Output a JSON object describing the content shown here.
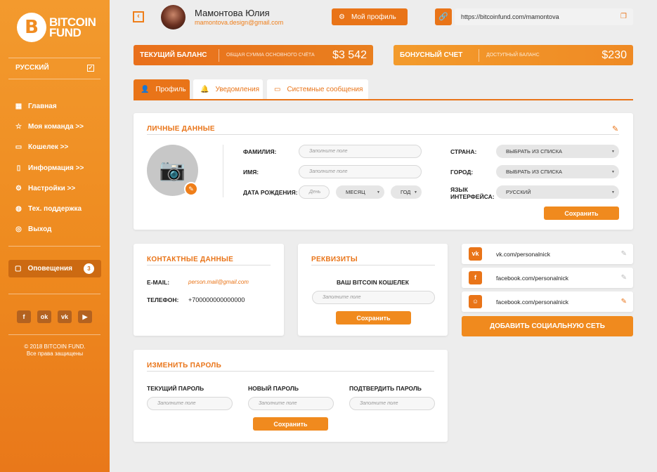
{
  "brand": {
    "line1": "BITCOIN",
    "line2": "FUND",
    "letter": "B"
  },
  "sidebar": {
    "language": "РУССКИЙ",
    "items": [
      {
        "label": "Главная",
        "icon": "grid-icon"
      },
      {
        "label": "Моя команда >>",
        "icon": "star-icon"
      },
      {
        "label": "Кошелек >>",
        "icon": "wallet-icon"
      },
      {
        "label": "Информация >>",
        "icon": "bookmark-icon"
      },
      {
        "label": "Настройки >>",
        "icon": "gear-icon"
      },
      {
        "label": "Тех. поддержка",
        "icon": "globe-icon"
      },
      {
        "label": "Выход",
        "icon": "power-icon"
      }
    ],
    "notifications": {
      "label": "Оповещения",
      "count": "3"
    },
    "socials": [
      "f",
      "ok",
      "vk",
      "yt"
    ],
    "copyright": "© 2018 BITCOIN FUND.",
    "rights": "Все права защищены"
  },
  "header": {
    "user_name": "Мамонтова Юлия",
    "user_email": "mamontova.design@gmail.com",
    "profile_button": "Мой профиль",
    "referral_link": "https://bitcoinfund.com/mamontova"
  },
  "balance": {
    "current_label": "ТЕКУЩИЙ БАЛАНС",
    "current_sub": "ОБЩАЯ СУММА ОСНОВНОГО СЧЁТА",
    "current_amount": "$3 542",
    "bonus_label": "БОНУСНЫЙ СЧЕТ",
    "bonus_sub": "ДОСТУПНЫЙ БАЛАНС",
    "bonus_amount": "$230"
  },
  "tabs": [
    {
      "label": "Профиль"
    },
    {
      "label": "Уведомления"
    },
    {
      "label": "Системные сообщения"
    }
  ],
  "personal": {
    "title": "ЛИЧНЫЕ ДАННЫЕ",
    "surname_label": "ФАМИЛИЯ:",
    "name_label": "ИМЯ:",
    "birth_label": "ДАТА РОЖДЕНИЯ:",
    "placeholder": "Заполните поле",
    "day_placeholder": "День",
    "month": "МЕСЯЦ",
    "year": "ГОД",
    "country_label": "СТРАНА:",
    "city_label": "ГОРОД:",
    "lang_label_1": "ЯЗЫК",
    "lang_label_2": "ИНТЕРФЕЙСА:",
    "choose": "ВЫБРАТЬ ИЗ СПИСКА",
    "lang_value": "РУССКИЙ",
    "save": "Сохранить"
  },
  "contacts": {
    "title": "КОНТАКТНЫЕ ДАННЫЕ",
    "email_label": "E-MAIL:",
    "email_value": "person.mail@gmail.com",
    "phone_label": "ТЕЛЕФОН:",
    "phone_value": "+700000000000000"
  },
  "requisites": {
    "title": "РЕКВИЗИТЫ",
    "wallet_label": "ВАШ BITCOIN КОШЕЛЕК",
    "placeholder": "Заполните поле",
    "save": "Сохранить"
  },
  "social_links": [
    {
      "icon": "vk",
      "url": "vk.com/personalnick"
    },
    {
      "icon": "f",
      "url": "facebook.com/personalnick"
    },
    {
      "icon": "chat",
      "url": "facebook.com/personalnick"
    }
  ],
  "add_social": "ДОБАВИТЬ СОЦИАЛЬНУЮ СЕТЬ",
  "password": {
    "title": "ИЗМЕНИТЬ ПАРОЛЬ",
    "current_label": "ТЕКУЩИЙ ПАРОЛЬ",
    "new_label": "НОВЫЙ ПАРОЛЬ",
    "confirm_label": "ПОДТВЕРДИТЬ ПАРОЛЬ",
    "placeholder": "Заполните поле",
    "save": "Сохранить"
  }
}
